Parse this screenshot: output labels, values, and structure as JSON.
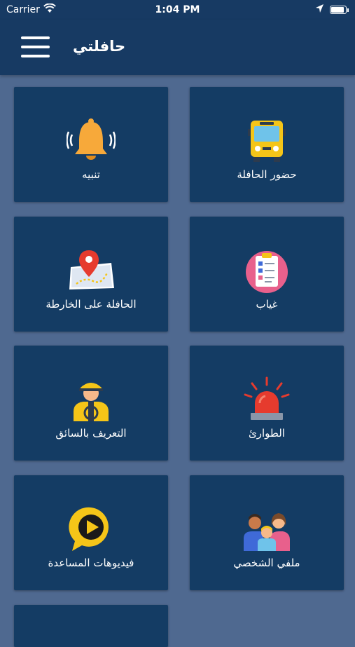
{
  "status_bar": {
    "carrier": "Carrier",
    "time": "1:04 PM"
  },
  "navbar": {
    "title": "حافلتي"
  },
  "tiles": [
    {
      "label": "حضور الحافلة",
      "icon": "school-bus-icon"
    },
    {
      "label": "تنبيه",
      "icon": "bell-icon"
    },
    {
      "label": "غياب",
      "icon": "clipboard-checklist-icon"
    },
    {
      "label": "الحافلة على الخارطة",
      "icon": "map-pin-icon"
    },
    {
      "label": "الطوارئ",
      "icon": "siren-icon"
    },
    {
      "label": "التعريف بالسائق",
      "icon": "driver-icon"
    },
    {
      "label": "ملفي الشخصي",
      "icon": "family-icon"
    },
    {
      "label": "فيديوهات المساعدة",
      "icon": "play-video-icon"
    }
  ],
  "colors": {
    "background": "#4f6990",
    "header": "#173a63",
    "tile": "#143c64"
  }
}
